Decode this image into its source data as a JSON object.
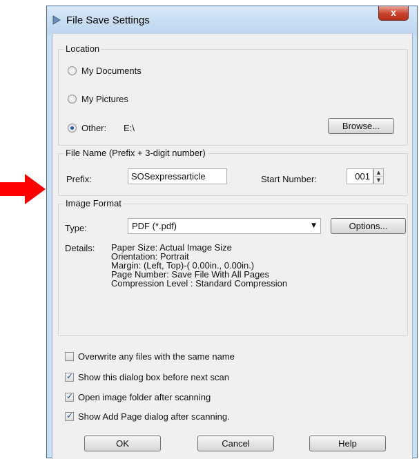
{
  "dialog": {
    "title": "File Save Settings",
    "close_label": "x"
  },
  "location": {
    "legend": "Location",
    "options": [
      {
        "label": "My Documents",
        "selected": false
      },
      {
        "label": "My Pictures",
        "selected": false
      },
      {
        "label": "Other:",
        "selected": true
      }
    ],
    "other_path": "E:\\",
    "browse_label": "Browse..."
  },
  "file_name": {
    "legend": "File Name (Prefix + 3-digit number)",
    "prefix_label": "Prefix:",
    "prefix_value": "SOSexpressarticle",
    "start_number_label": "Start Number:",
    "start_number_value": "001"
  },
  "image_format": {
    "legend": "Image Format",
    "type_label": "Type:",
    "type_value": "PDF (*.pdf)",
    "options_label": "Options...",
    "details_label": "Details:",
    "details": [
      "Paper Size: Actual Image Size",
      "Orientation: Portrait",
      "Margin: (Left, Top)-( 0.00in., 0.00in.)",
      "Page Number: Save File With All Pages",
      "Compression Level : Standard Compression"
    ]
  },
  "checkboxes": [
    {
      "label": "Overwrite any files with the same name",
      "checked": false
    },
    {
      "label": "Show this dialog box before next scan",
      "checked": true
    },
    {
      "label": "Open image folder after scanning",
      "checked": true
    },
    {
      "label": "Show Add Page dialog after scanning.",
      "checked": true
    }
  ],
  "buttons": {
    "ok": "OK",
    "cancel": "Cancel",
    "help": "Help"
  },
  "colors": {
    "annotation_arrow": "#ff0000",
    "accent": "#1d58b3"
  }
}
